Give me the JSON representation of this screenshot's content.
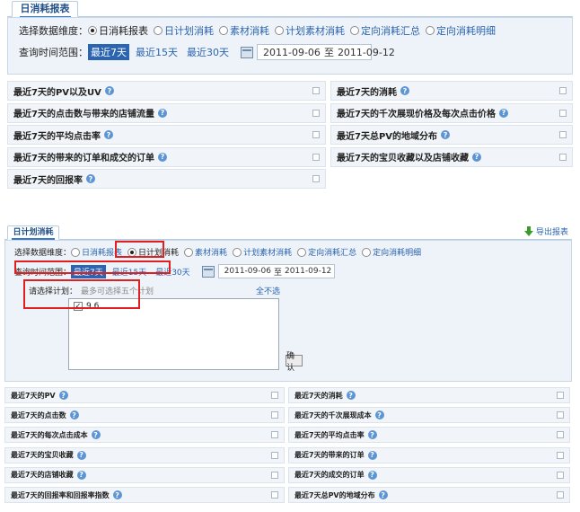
{
  "top": {
    "tab_label": "日消耗报表",
    "dim_label": "选择数据维度：",
    "dims": [
      "日消耗报表",
      "日计划消耗",
      "素材消耗",
      "计划素材消耗",
      "定向消耗汇总",
      "定向消耗明细"
    ],
    "selected_dim": "日消耗报表",
    "range_label": "查询时间范围：",
    "ranges": [
      "最近7天",
      "最近15天",
      "最近30天"
    ],
    "selected_range": "最近7天",
    "date_start": "2011-09-06",
    "date_sep": "至",
    "date_end": "2011-09-12",
    "left_items": [
      "最近7天的PV以及UV",
      "最近7天的点击数与带来的店铺流量",
      "最近7天的平均点击率",
      "最近7天的带来的订单和成交的订单",
      "最近7天的回报率"
    ],
    "right_items": [
      "最近7天的消耗",
      "最近7天的千次展现价格及每次点击价格",
      "最近7天总PV的地域分布",
      "最近7天的宝贝收藏以及店铺收藏"
    ]
  },
  "bottom": {
    "tab_label": "日计划消耗",
    "export_label": "导出报表",
    "dim_label": "选择数据维度：",
    "dims": [
      "日消耗报表",
      "日计划消耗",
      "素材消耗",
      "计划素材消耗",
      "定向消耗汇总",
      "定向消耗明细"
    ],
    "selected_dim": "日计划消耗",
    "range_label": "查询时间范围：",
    "ranges": [
      "最近7天",
      "最近15天",
      "最近30天"
    ],
    "selected_range": "最近7天",
    "date_start": "2011-09-06",
    "date_sep": "至",
    "date_end": "2011-09-12",
    "plan_label": "请选择计划：",
    "plan_hint": "最多可选择五个计划",
    "deselect_label": "全不选",
    "plans": [
      {
        "name": "9.6",
        "checked": true
      }
    ],
    "confirm_label": "确认",
    "left_items": [
      "最近7天的PV",
      "最近7天的点击数",
      "最近7天的每次点击成本",
      "最近7天的宝贝收藏",
      "最近7天的店铺收藏",
      "最近7天的回报率和回报率指数"
    ],
    "right_items": [
      "最近7天的消耗",
      "最近7天的千次展现成本",
      "最近7天的平均点击率",
      "最近7天的带来的订单",
      "最近7天的成交的订单",
      "最近7天总PV的地域分布"
    ]
  },
  "colors": {
    "link": "#2b64b0",
    "highlight": "#e02020",
    "export_arrow": "#3a9a2a",
    "help_icon": "#5d95d3"
  }
}
